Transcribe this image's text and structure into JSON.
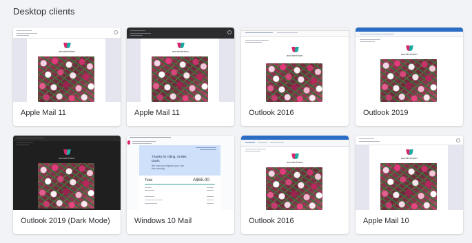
{
  "section": {
    "title": "Desktop clients"
  },
  "brand": {
    "name": "wonderblum"
  },
  "clients": [
    {
      "label": "Apple Mail 11"
    },
    {
      "label": "Apple Mail 11"
    },
    {
      "label": "Outlook 2016"
    },
    {
      "label": "Outlook 2019"
    },
    {
      "label": "Outlook 2019 (Dark Mode)"
    },
    {
      "label": "Windows 10 Mail"
    },
    {
      "label": "Outlook 2016"
    },
    {
      "label": "Apple Mail 10"
    }
  ],
  "win10_preview": {
    "header": "Thanks for riding, Smiles Davis",
    "subtext": "We hope you enjoyed your ride this morning",
    "total_label": "Total",
    "total_value": "A$65.00"
  },
  "colors": {
    "page_bg": "#f2f3f6",
    "outlook_blue": "#2b6dc4",
    "dark_bg": "#1f1f1f",
    "win10_header": "#cfe0fb"
  }
}
